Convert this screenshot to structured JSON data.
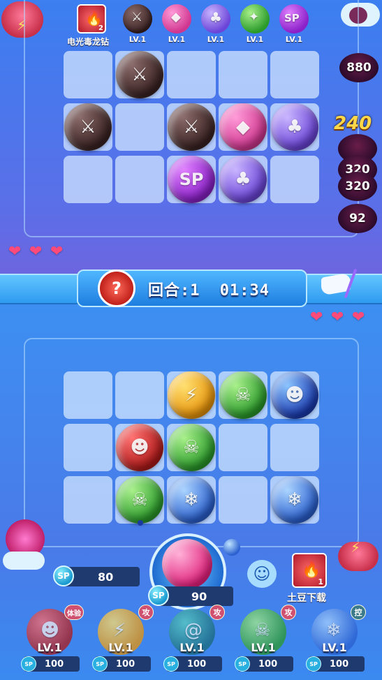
{
  "top": {
    "item_name": "电光毒龙钻",
    "item_count": "2",
    "skills": [
      {
        "level": "LV.1",
        "icon": "sword-icon"
      },
      {
        "level": "LV.1",
        "icon": "pink-gem-icon"
      },
      {
        "level": "LV.1",
        "icon": "clover-icon"
      },
      {
        "level": "LV.1",
        "icon": "shuriken-icon"
      },
      {
        "level": "LV.1",
        "icon": "sp-icon"
      }
    ],
    "enemies": [
      "880",
      "240",
      "320",
      "320",
      "92"
    ],
    "orb_labels": {
      "sp": "SP"
    }
  },
  "banner": {
    "round_label": "回合:1",
    "timer": "01:34"
  },
  "bottom": {
    "sp_left": {
      "badge": "SP",
      "value": "80"
    },
    "sp_center": {
      "badge": "SP",
      "value": "90"
    },
    "item_name": "土豆下载",
    "item_count": "1",
    "skills": [
      {
        "level": "LV.1",
        "sp_badge": "SP",
        "sp": "100",
        "tag": "体验"
      },
      {
        "level": "LV.1",
        "sp_badge": "SP",
        "sp": "100",
        "tag": "攻"
      },
      {
        "level": "LV.1",
        "sp_badge": "SP",
        "sp": "100",
        "tag": "攻"
      },
      {
        "level": "LV.1",
        "sp_badge": "SP",
        "sp": "100",
        "tag": "攻"
      },
      {
        "level": "LV.1",
        "sp_badge": "SP",
        "sp": "100",
        "tag": "控"
      }
    ]
  },
  "colors": {
    "heart": "#ff4a7a",
    "banner": "#2f9af0"
  }
}
